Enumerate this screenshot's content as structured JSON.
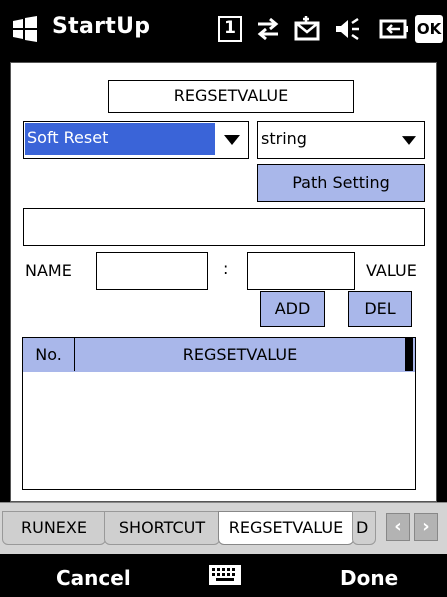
{
  "titlebar": {
    "app_title": "StartUp",
    "icons": [
      "windows-flag-icon",
      "sim-indicator-icon",
      "connectivity-icon",
      "new-message-icon",
      "volume-muted-icon",
      "battery-charging-icon",
      "ok-icon"
    ],
    "ok_label": "OK",
    "sim_label": "1"
  },
  "form": {
    "section_title": "REGSETVALUE",
    "action_select": "Soft Reset",
    "type_select": "string",
    "path_button": "Path Setting",
    "path_value": "",
    "name_label": "NAME",
    "separator": ":",
    "value_label": "VALUE",
    "name_value": "",
    "value_value": "",
    "add_button": "ADD",
    "del_button": "DEL"
  },
  "table": {
    "headers": [
      "No.",
      "REGSETVALUE"
    ],
    "rows": []
  },
  "tabs": {
    "items": [
      "RUNEXE",
      "SHORTCUT",
      "REGSETVALUE",
      "D"
    ],
    "active": "REGSETVALUE",
    "prev_icon": "arrow-left-icon",
    "next_icon": "arrow-right-icon"
  },
  "softkeys": {
    "left": "Cancel",
    "right": "Done",
    "center_icon": "keyboard-icon"
  },
  "colors": {
    "selection": "#3a64d8",
    "button_bg": "#a9b7ea",
    "bar_bg": "#000000"
  }
}
